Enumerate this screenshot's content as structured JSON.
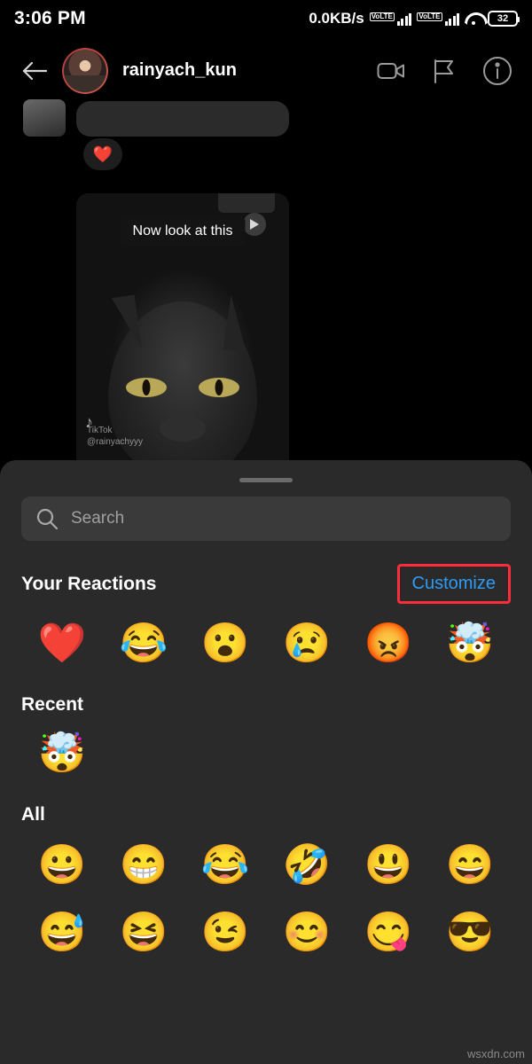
{
  "status_bar": {
    "time": "3:06 PM",
    "network_speed": "0.0KB/s",
    "sim1_label": "VoLTE",
    "sim2_label": "VoLTE",
    "battery_level": "32"
  },
  "chat_header": {
    "back_icon": "back-arrow-icon",
    "username": "rainyach_kun",
    "video_call_icon": "video-camera-icon",
    "flag_icon": "flag-icon",
    "info_icon": "info-circle-icon"
  },
  "conversation": {
    "reaction_emoji": "❤️",
    "video_caption": "Now look at this",
    "tiktok_watermark": "TikTok",
    "tiktok_handle": "@rainyachyyy"
  },
  "sheet": {
    "search": {
      "placeholder": "Search",
      "value": "",
      "icon": "search-icon"
    },
    "your_reactions": {
      "title": "Your Reactions",
      "customize_label": "Customize",
      "emojis": [
        "❤️",
        "😂",
        "😮",
        "😢",
        "😡",
        "🤯"
      ]
    },
    "recent": {
      "title": "Recent",
      "emojis": [
        "🤯"
      ]
    },
    "all": {
      "title": "All",
      "emojis": [
        "😀",
        "😁",
        "😂",
        "🤣",
        "😃",
        "😄",
        "😅",
        "😆",
        "😉",
        "😊",
        "😋",
        "😎"
      ]
    }
  },
  "watermark": "wsxdn.com",
  "colors": {
    "accent_blue": "#2f9bf5",
    "highlight_red": "#ff2d3b",
    "sheet_bg": "#2a2a2a",
    "search_bg": "#3a3a3a"
  }
}
